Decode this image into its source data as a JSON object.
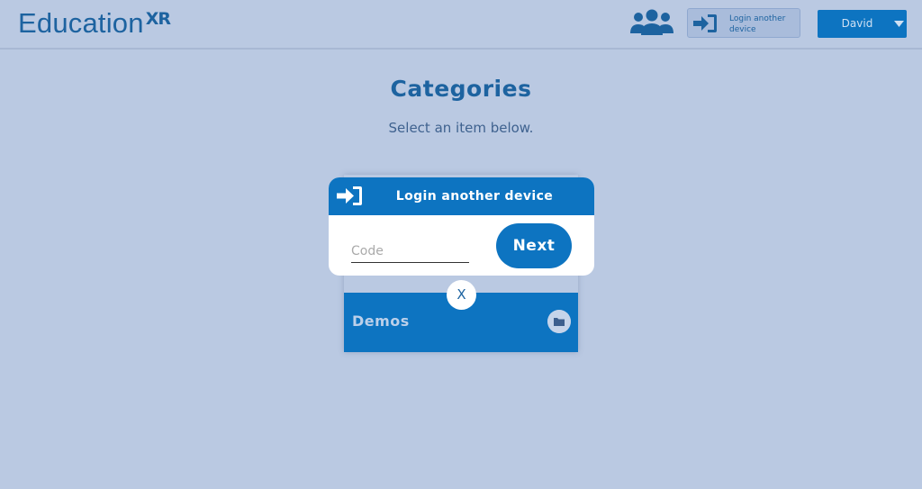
{
  "header": {
    "logo_main": "Education",
    "logo_suffix": "XR",
    "login_device_label": "Login another device",
    "user_name": "David"
  },
  "main": {
    "title": "Categories",
    "subtitle": "Select an item below.",
    "categories": [
      {
        "label": "Demos",
        "icon": "folder-icon"
      }
    ]
  },
  "modal": {
    "title": "Login another device",
    "code_placeholder": "Code",
    "code_value": "",
    "next_label": "Next",
    "close_label": "X"
  },
  "icons": {
    "users": "users-icon",
    "login": "sign-in-icon",
    "caret": "caret-down-icon",
    "folder": "folder-icon"
  },
  "colors": {
    "background": "#bac9e2",
    "brand_blue": "#0d74c1",
    "text_blue": "#1d63a0",
    "white": "#ffffff"
  }
}
